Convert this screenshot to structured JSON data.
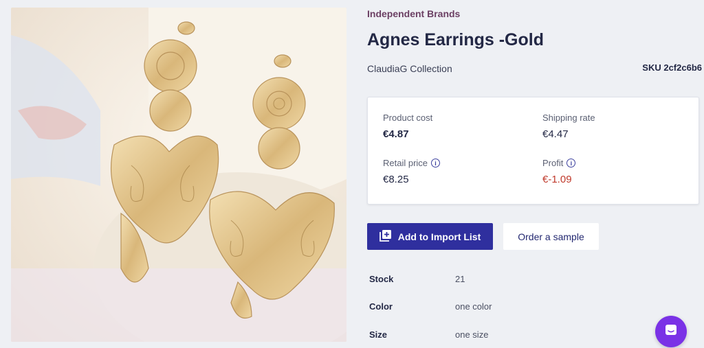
{
  "product": {
    "brand": "Independent Brands",
    "title": "Agnes Earrings -Gold",
    "collection": "ClaudiaG Collection",
    "sku": "SKU 2cf2c6b6",
    "image_alt": "earrings-photo"
  },
  "pricing": {
    "product_cost_label": "Product cost",
    "product_cost_value": "€4.87",
    "shipping_rate_label": "Shipping rate",
    "shipping_rate_value": "€4.47",
    "retail_price_label": "Retail price",
    "retail_price_value": "€8.25",
    "profit_label": "Profit",
    "profit_value": "€-1.09"
  },
  "actions": {
    "add_to_import_list": "Add to Import List",
    "order_sample": "Order a sample"
  },
  "attributes": [
    {
      "key": "Stock",
      "value": "21"
    },
    {
      "key": "Color",
      "value": "one color"
    },
    {
      "key": "Size",
      "value": "one size"
    }
  ],
  "colors": {
    "accent": "#2f2f9e",
    "brand_text": "#6b3f63",
    "negative": "#c0392b",
    "chat": "#7a32e6"
  },
  "icons": {
    "info": "info-icon",
    "add_list": "add-list-icon",
    "chat": "chat-icon"
  }
}
